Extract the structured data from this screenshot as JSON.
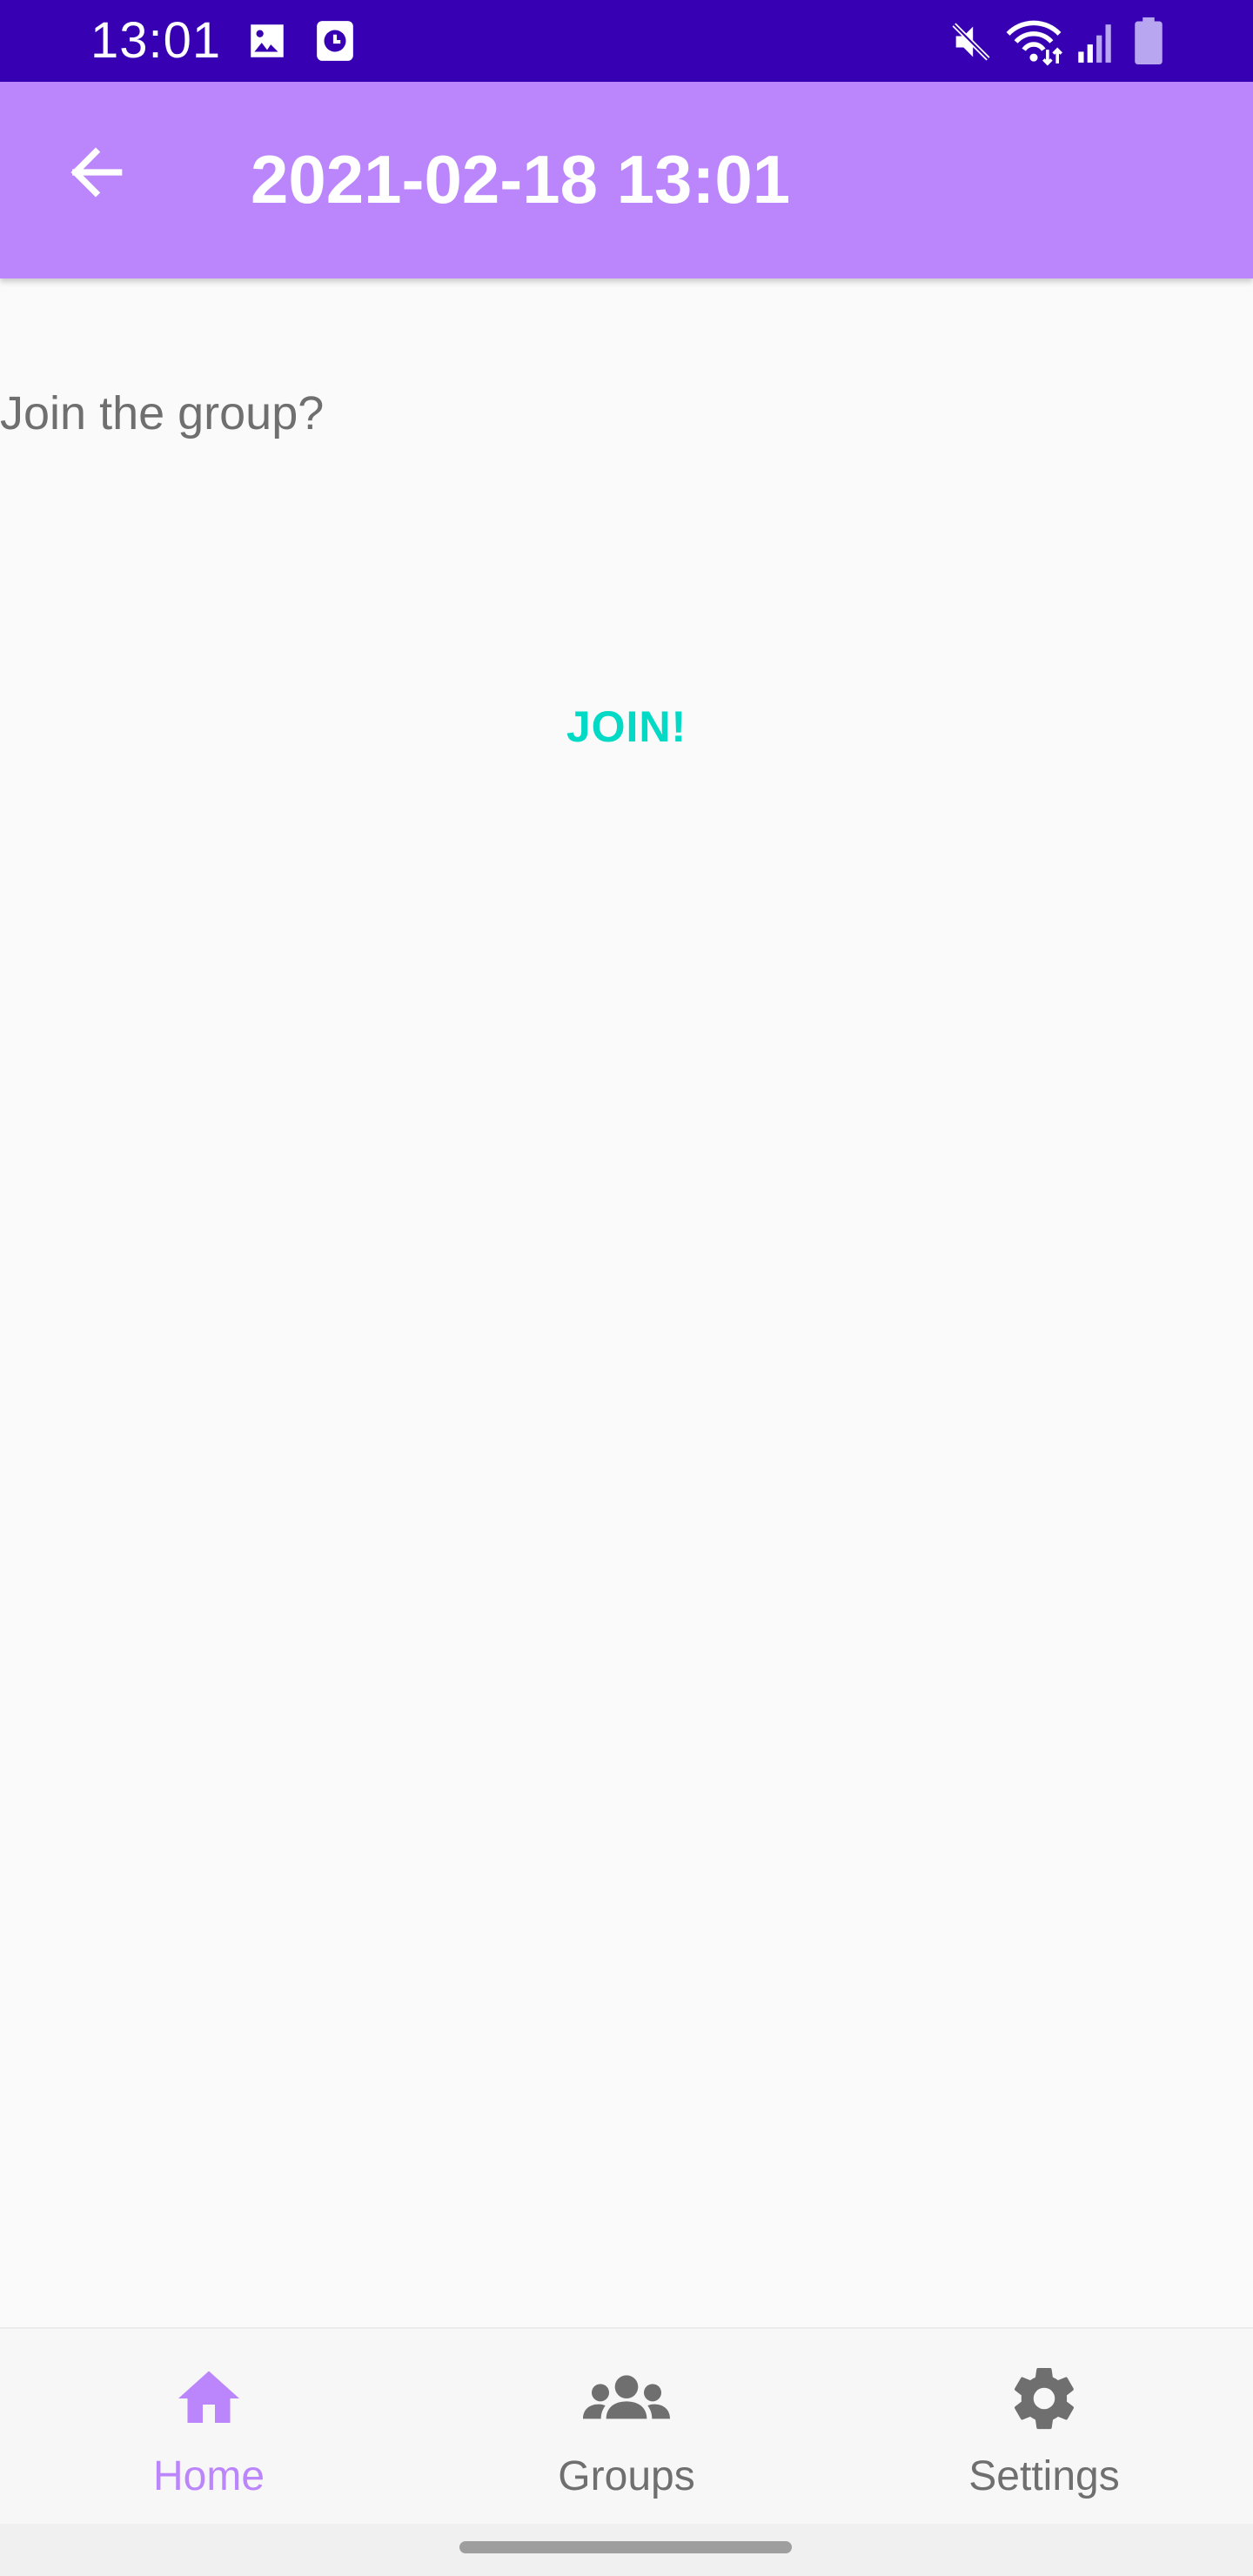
{
  "status_bar": {
    "time": "13:01",
    "background": "#3700b3",
    "icons": [
      "image-icon",
      "alarm-icon",
      "mute-icon",
      "wifi-icon",
      "signal-icon",
      "battery-icon"
    ]
  },
  "app_bar": {
    "title": "2021-02-18 13:01",
    "background": "#bb86fc",
    "back_icon": "arrow-back-icon"
  },
  "content": {
    "prompt": "Join the group?",
    "join_label": "JOIN!",
    "join_color": "#03dac5"
  },
  "bottom_nav": {
    "active_color": "#bb86fc",
    "inactive_color": "#6f6f6f",
    "items": [
      {
        "label": "Home",
        "icon": "home-icon",
        "active": true
      },
      {
        "label": "Groups",
        "icon": "groups-icon",
        "active": false
      },
      {
        "label": "Settings",
        "icon": "gear-icon",
        "active": false
      }
    ]
  }
}
